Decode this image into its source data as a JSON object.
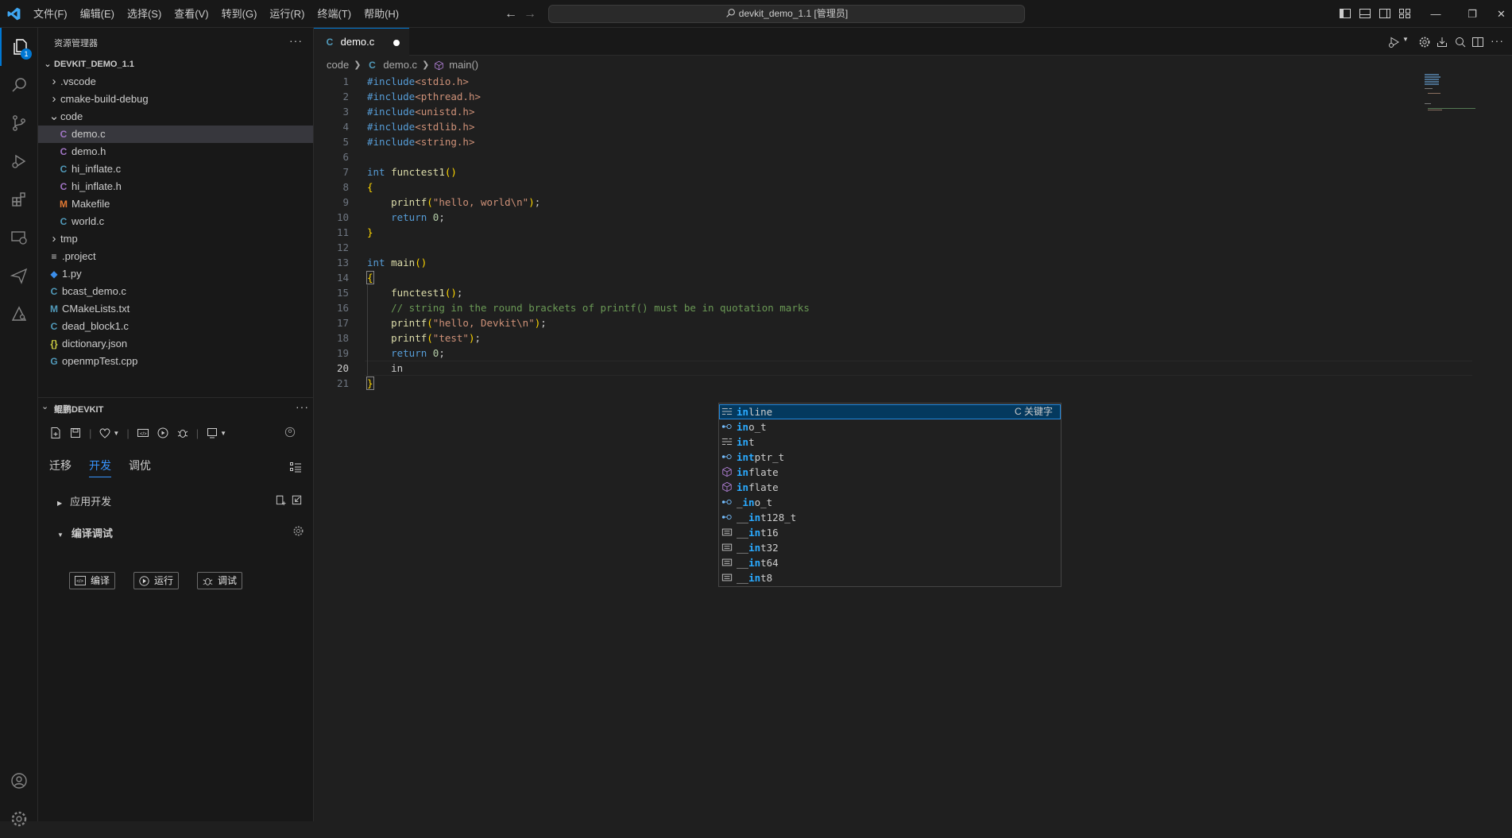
{
  "titlebar": {
    "menus": [
      "文件(F)",
      "编辑(E)",
      "选择(S)",
      "查看(V)",
      "转到(G)",
      "运行(R)",
      "终端(T)",
      "帮助(H)"
    ],
    "command_center": "devkit_demo_1.1 [管理员]"
  },
  "activitybar": {
    "explorer_badge": "1"
  },
  "explorer": {
    "title": "资源管理器",
    "root": "DEVKIT_DEMO_1.1",
    "items": [
      {
        "label": ".vscode",
        "kind": "folder",
        "state": "collapsed",
        "depth": 1
      },
      {
        "label": "cmake-build-debug",
        "kind": "folder",
        "state": "collapsed",
        "depth": 1
      },
      {
        "label": "code",
        "kind": "folder",
        "state": "expanded",
        "depth": 1
      },
      {
        "label": "demo.c",
        "kind": "c",
        "icon": "C",
        "depth": 2,
        "selected": true
      },
      {
        "label": "demo.h",
        "kind": "c",
        "icon": "C",
        "depth": 2
      },
      {
        "label": "hi_inflate.c",
        "kind": "cpp",
        "icon": "C",
        "depth": 2
      },
      {
        "label": "hi_inflate.h",
        "kind": "c",
        "icon": "C",
        "depth": 2
      },
      {
        "label": "Makefile",
        "kind": "m",
        "icon": "M",
        "depth": 2
      },
      {
        "label": "world.c",
        "kind": "cpp",
        "icon": "C",
        "depth": 2
      },
      {
        "label": "tmp",
        "kind": "folder",
        "state": "collapsed",
        "depth": 1
      },
      {
        "label": ".project",
        "kind": "proj",
        "icon": "≡",
        "depth": 1
      },
      {
        "label": "1.py",
        "kind": "py",
        "icon": "◆",
        "depth": 1
      },
      {
        "label": "bcast_demo.c",
        "kind": "cpp",
        "icon": "C",
        "depth": 1
      },
      {
        "label": "CMakeLists.txt",
        "kind": "cmake",
        "icon": "M",
        "depth": 1
      },
      {
        "label": "dead_block1.c",
        "kind": "cpp",
        "icon": "C",
        "depth": 1
      },
      {
        "label": "dictionary.json",
        "kind": "json",
        "icon": "{}",
        "depth": 1
      },
      {
        "label": "openmpTest.cpp",
        "kind": "cpp",
        "icon": "G",
        "depth": 1
      }
    ]
  },
  "devkit": {
    "title": "鲲鹏DEVKIT",
    "tabs": [
      "迁移",
      "开发",
      "调优"
    ],
    "active_tab": "开发",
    "section_app": "应用开发",
    "section_build": "编译调试",
    "buttons": {
      "compile": "编译",
      "run": "运行",
      "debug": "调试"
    }
  },
  "editor": {
    "tab_label": "demo.c",
    "tab_icon": "C",
    "breadcrumb": {
      "folder": "code",
      "file": "demo.c",
      "symbol": "main()"
    },
    "current_line": 20,
    "lines": [
      {
        "n": "1",
        "tokens": [
          [
            "pp",
            "#include"
          ],
          [
            "str",
            "<stdio.h>"
          ]
        ]
      },
      {
        "n": "2",
        "tokens": [
          [
            "pp",
            "#include"
          ],
          [
            "str",
            "<pthread.h>"
          ]
        ]
      },
      {
        "n": "3",
        "tokens": [
          [
            "pp",
            "#include"
          ],
          [
            "str",
            "<unistd.h>"
          ]
        ]
      },
      {
        "n": "4",
        "tokens": [
          [
            "pp",
            "#include"
          ],
          [
            "str",
            "<stdlib.h>"
          ]
        ]
      },
      {
        "n": "5",
        "tokens": [
          [
            "pp",
            "#include"
          ],
          [
            "str",
            "<string.h>"
          ]
        ]
      },
      {
        "n": "6",
        "tokens": []
      },
      {
        "n": "7",
        "tokens": [
          [
            "kw",
            "int"
          ],
          [
            "pl",
            " "
          ],
          [
            "fn",
            "functest1"
          ],
          [
            "br1",
            "()"
          ]
        ]
      },
      {
        "n": "8",
        "tokens": [
          [
            "br1",
            "{"
          ]
        ]
      },
      {
        "n": "9",
        "tokens": [
          [
            "pl",
            "    "
          ],
          [
            "fn",
            "printf"
          ],
          [
            "br1",
            "("
          ],
          [
            "str",
            "\"hello, world\\n\""
          ],
          [
            "br1",
            ")"
          ],
          [
            "pl",
            ";"
          ]
        ]
      },
      {
        "n": "10",
        "tokens": [
          [
            "pl",
            "    "
          ],
          [
            "kw",
            "return"
          ],
          [
            "pl",
            " "
          ],
          [
            "num",
            "0"
          ],
          [
            "pl",
            ";"
          ]
        ]
      },
      {
        "n": "11",
        "tokens": [
          [
            "br1",
            "}"
          ]
        ]
      },
      {
        "n": "12",
        "tokens": []
      },
      {
        "n": "13",
        "tokens": [
          [
            "kw",
            "int"
          ],
          [
            "pl",
            " "
          ],
          [
            "fn",
            "main"
          ],
          [
            "br1",
            "()"
          ]
        ]
      },
      {
        "n": "14",
        "tokens": [
          [
            "br1",
            "{"
          ]
        ]
      },
      {
        "n": "15",
        "tokens": [
          [
            "pl",
            "    "
          ],
          [
            "fn",
            "functest1"
          ],
          [
            "br1",
            "()"
          ],
          [
            "pl",
            ";"
          ]
        ]
      },
      {
        "n": "16",
        "tokens": [
          [
            "pl",
            "    "
          ],
          [
            "cm",
            "// string in the round brackets of printf() must be in quotation marks"
          ]
        ]
      },
      {
        "n": "17",
        "tokens": [
          [
            "pl",
            "    "
          ],
          [
            "fn",
            "printf"
          ],
          [
            "br1",
            "("
          ],
          [
            "str",
            "\"hello, Devkit\\n\""
          ],
          [
            "br1",
            ")"
          ],
          [
            "pl",
            ";"
          ]
        ]
      },
      {
        "n": "18",
        "tokens": [
          [
            "pl",
            "    "
          ],
          [
            "fn",
            "printf"
          ],
          [
            "br1",
            "("
          ],
          [
            "str",
            "\"test\""
          ],
          [
            "br1",
            ")"
          ],
          [
            "pl",
            ";"
          ]
        ]
      },
      {
        "n": "19",
        "tokens": [
          [
            "pl",
            "    "
          ],
          [
            "kw",
            "return"
          ],
          [
            "pl",
            " "
          ],
          [
            "num",
            "0"
          ],
          [
            "pl",
            ";"
          ]
        ]
      },
      {
        "n": "20",
        "tokens": [
          [
            "pl",
            "    in"
          ]
        ]
      },
      {
        "n": "21",
        "tokens": [
          [
            "br1",
            "}"
          ]
        ]
      }
    ]
  },
  "suggest": {
    "typed_prefix": "in",
    "items": [
      {
        "label": "inline",
        "match": "in",
        "icon": "keyword",
        "detail": "C 关键字",
        "focused": true
      },
      {
        "label": "ino_t",
        "match": "in",
        "icon": "typedef"
      },
      {
        "label": "int",
        "match": "in",
        "icon": "keyword"
      },
      {
        "label": "intptr_t",
        "match": "int",
        "icon": "typedef"
      },
      {
        "label": "inflate",
        "match": "in",
        "icon": "method"
      },
      {
        "label": "inflate",
        "match": "in",
        "icon": "method"
      },
      {
        "label": "_ino_t",
        "match": "",
        "icon": "typedef"
      },
      {
        "label": "__int128_t",
        "match": "",
        "icon": "typedef"
      },
      {
        "label": "__int16",
        "match": "",
        "icon": "text"
      },
      {
        "label": "__int32",
        "match": "",
        "icon": "text"
      },
      {
        "label": "__int64",
        "match": "",
        "icon": "text"
      },
      {
        "label": "__int8",
        "match": "",
        "icon": "text"
      }
    ]
  },
  "colors": {
    "accent": "#0078d4",
    "suggest_highlight": "#2aaaff",
    "keyword": "#569cd6",
    "string": "#ce9178",
    "comment": "#6a9955",
    "function": "#dcdcaa"
  }
}
